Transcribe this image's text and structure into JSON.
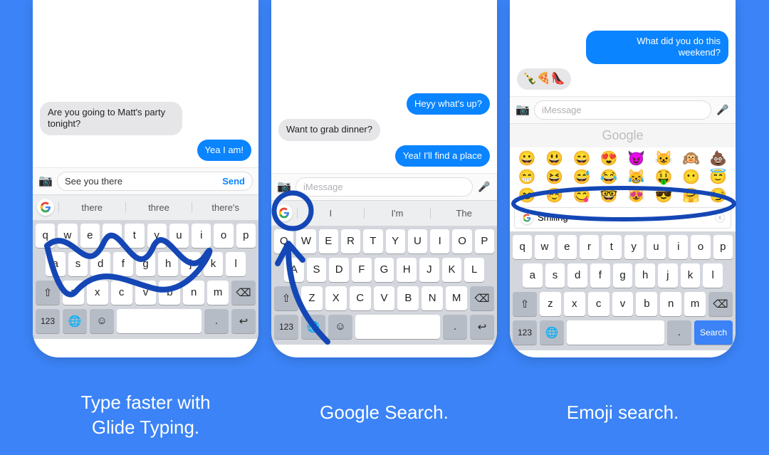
{
  "captions": {
    "c1": "Type faster with\nGlide Typing.",
    "c2": "Google Search.",
    "c3": "Emoji search."
  },
  "panel1": {
    "msg_in": "Are you going to Matt's party tonight?",
    "msg_out": "Yea I am!",
    "compose_text": "See you there",
    "send_label": "Send",
    "suggestions": [
      "there",
      "three",
      "there's"
    ],
    "row1": [
      "q",
      "w",
      "e",
      "r",
      "t",
      "y",
      "u",
      "i",
      "o",
      "p"
    ],
    "row2": [
      "a",
      "s",
      "d",
      "f",
      "g",
      "h",
      "j",
      "k",
      "l"
    ],
    "row3": [
      "z",
      "x",
      "c",
      "v",
      "b",
      "n",
      "m"
    ],
    "key_123": "123",
    "key_dot": "."
  },
  "panel2": {
    "msg_out1": "Heyy what's up?",
    "msg_in": "Want to grab dinner?",
    "msg_out2": "Yea! I'll find a place",
    "compose_ph": "iMessage",
    "suggestions": [
      "I",
      "I'm",
      "The"
    ],
    "row1": [
      "Q",
      "W",
      "E",
      "R",
      "T",
      "Y",
      "U",
      "I",
      "O",
      "P"
    ],
    "row2": [
      "A",
      "S",
      "D",
      "F",
      "G",
      "H",
      "J",
      "K",
      "L"
    ],
    "row3": [
      "Z",
      "X",
      "C",
      "V",
      "B",
      "N",
      "M"
    ],
    "key_123": "123",
    "key_dot": "."
  },
  "panel3": {
    "msg_out": "What did you do this weekend?",
    "msg_in_emoji": "🍾🍕👠",
    "compose_ph": "iMessage",
    "google_label": "Google",
    "emoji_grid": [
      "😀",
      "😃",
      "😄",
      "😍",
      "😈",
      "😺",
      "🙉",
      "💩",
      "😁",
      "😆",
      "😅",
      "😂",
      "😹",
      "🤑",
      "😶",
      "😇",
      "😊",
      "☺️",
      "😋",
      "🤓",
      "😻",
      "😎",
      "🤗",
      "😏"
    ],
    "search_value": "Smiling",
    "row1": [
      "q",
      "w",
      "e",
      "r",
      "t",
      "y",
      "u",
      "i",
      "o",
      "p"
    ],
    "row2": [
      "a",
      "s",
      "d",
      "f",
      "g",
      "h",
      "j",
      "k",
      "l"
    ],
    "row3": [
      "z",
      "x",
      "c",
      "v",
      "b",
      "n",
      "m"
    ],
    "key_123": "123",
    "key_dot": ".",
    "search_btn": "Search"
  }
}
